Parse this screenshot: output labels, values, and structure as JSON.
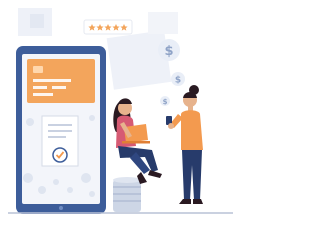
{
  "illustration": {
    "rating": {
      "stars": 5,
      "of": 5
    },
    "icons": [
      "dollar-coin-icon",
      "dollar-coin-icon",
      "dollar-coin-icon",
      "star-icon",
      "check-icon",
      "laptop-icon",
      "phone-icon"
    ]
  },
  "colors": {
    "phone_body": "#3d5d9a",
    "phone_screen": "#f3f5fa",
    "card": "#f3a55c",
    "accent_orange": "#f39a4f",
    "coin": "#e9eef7",
    "backdrop": "#eef1f8",
    "star": "#f3a55c",
    "navy": "#273b6b",
    "skin": "#e7b38d",
    "hair_dark": "#2a1a22",
    "pink_top": "#d65a73",
    "ground": "#b9c2d6"
  }
}
